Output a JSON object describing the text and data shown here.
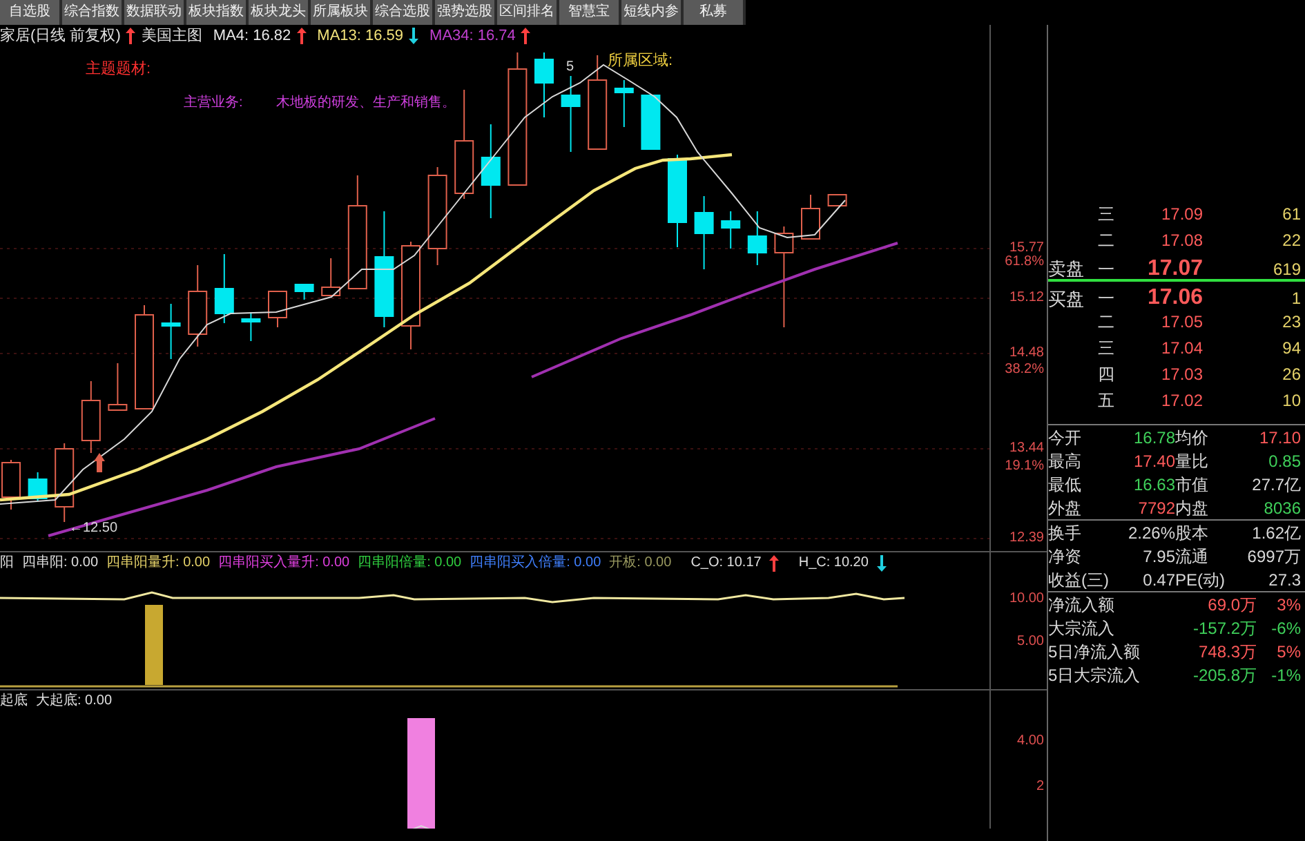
{
  "toolbar": {
    "buttons": [
      "自选股",
      "综合指数",
      "数据联动",
      "板块指数",
      "板块龙头",
      "所属板块",
      "综合选股",
      "强势选股",
      "区间排名",
      "智慧宝",
      "短线内参",
      "私募"
    ]
  },
  "main_chart": {
    "title": "家居(日线 前复权)",
    "template": "美国主图",
    "ma": [
      {
        "label": "MA4: 16.82",
        "color": "#e8e8e8",
        "rising": true
      },
      {
        "label": "MA13: 16.59",
        "color": "#f2e27a",
        "rising": false
      },
      {
        "label": "MA34: 16.74",
        "color": "#c040d0",
        "rising": true
      }
    ],
    "theme_label": "主题题材:",
    "business_label": "主营业务:",
    "business": "木地板的研发、生产和销售。",
    "region_label": "所属区域:",
    "high_mark": "5",
    "low_mark": "←12.50",
    "axis": [
      "15.77",
      "61.8%",
      "15.12",
      "14.48",
      "38.2%",
      "13.44",
      "19.1%",
      "12.39"
    ]
  },
  "indicator_1": {
    "title": "阳",
    "values": [
      {
        "label": "四串阳: 0.00",
        "color": "#e0e0e0"
      },
      {
        "label": "四串阳量升: 0.00",
        "color": "#e6d36a"
      },
      {
        "label": "四串阳买入量升: 0.00",
        "color": "#e040e0"
      },
      {
        "label": "四串阳倍量: 0.00",
        "color": "#30d040"
      },
      {
        "label": "四串阳买入倍量: 0.00",
        "color": "#4080ff"
      },
      {
        "label": "开板: 0.00",
        "color": "#9a9a60"
      }
    ],
    "marks": [
      {
        "label": "C_O: 10.17",
        "rising": true
      },
      {
        "label": "H_C: 10.20",
        "rising": false
      }
    ],
    "axis": [
      "10.00",
      "5.00"
    ]
  },
  "indicator_2": {
    "title": "起底",
    "values": [
      {
        "label": "大起底: 0.00",
        "color": "#e0e0e0"
      }
    ],
    "axis": [
      "4.00",
      "2"
    ]
  },
  "order_book": {
    "sell_label": "卖盘",
    "buy_label": "买盘",
    "sell": [
      {
        "level": "三",
        "price": "17.09",
        "volume": "61"
      },
      {
        "level": "二",
        "price": "17.08",
        "volume": "22"
      },
      {
        "level": "一",
        "price": "17.07",
        "volume": "619"
      }
    ],
    "buy": [
      {
        "level": "一",
        "price": "17.06",
        "volume": "1"
      },
      {
        "level": "二",
        "price": "17.05",
        "volume": "23"
      },
      {
        "level": "三",
        "price": "17.04",
        "volume": "94"
      },
      {
        "level": "四",
        "price": "17.03",
        "volume": "26"
      },
      {
        "level": "五",
        "price": "17.02",
        "volume": "10"
      }
    ]
  },
  "stats": [
    [
      [
        {
          "label": "今开",
          "value": "16.78",
          "color": "#3fd05a"
        },
        {
          "label": "均价",
          "value": "17.10",
          "color": "#ff5a5a"
        }
      ],
      [
        {
          "label": "最高",
          "value": "17.40",
          "color": "#ff5a5a"
        },
        {
          "label": "量比",
          "value": "0.85",
          "color": "#3fd05a"
        }
      ],
      [
        {
          "label": "最低",
          "value": "16.63",
          "color": "#3fd05a"
        },
        {
          "label": "市值",
          "value": "27.7亿",
          "color": "#d8d8d8"
        }
      ],
      [
        {
          "label": "外盘",
          "value": "7792",
          "color": "#ff5a5a"
        },
        {
          "label": "内盘",
          "value": "8036",
          "color": "#3fd05a"
        }
      ]
    ],
    [
      [
        {
          "label": "换手",
          "value": "2.26%",
          "color": "#d8d8d8"
        },
        {
          "label": "股本",
          "value": "1.62亿",
          "color": "#d8d8d8"
        }
      ],
      [
        {
          "label": "净资",
          "value": "7.95",
          "color": "#d8d8d8"
        },
        {
          "label": "流通",
          "value": "6997万",
          "color": "#d8d8d8"
        }
      ],
      [
        {
          "label": "收益(三)",
          "value": "0.47",
          "color": "#d8d8d8"
        },
        {
          "label": "PE(动)",
          "value": "27.3",
          "color": "#d8d8d8"
        }
      ]
    ]
  ],
  "flows": [
    {
      "label": "净流入额",
      "value": "69.0万",
      "percent": "3%",
      "color": "#ff5a5a"
    },
    {
      "label": "大宗流入",
      "value": "-157.2万",
      "percent": "-6%",
      "color": "#3fd05a"
    },
    {
      "label": "5日净流入额",
      "value": "748.3万",
      "percent": "5%",
      "color": "#ff5a5a"
    },
    {
      "label": "5日大宗流入",
      "value": "-205.8万",
      "percent": "-1%",
      "color": "#3fd05a"
    }
  ]
}
